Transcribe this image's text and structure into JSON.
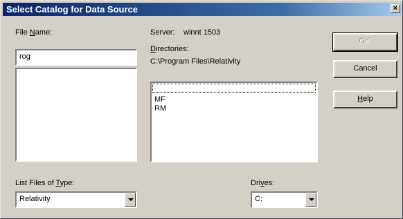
{
  "window": {
    "title": "Select Catalog for Data Source",
    "close_glyph": "×"
  },
  "file_name": {
    "label_prefix": "File ",
    "label_mnemonic": "N",
    "label_suffix": "ame:",
    "value": "rog",
    "files": []
  },
  "server": {
    "label": "Server:",
    "value": "winnt 1503"
  },
  "directories": {
    "label_mnemonic": "D",
    "label_suffix": "irectories:",
    "current_path": "C:\\Program Files\\Relativity",
    "items": [
      "MF",
      "RM"
    ]
  },
  "list_files_of_type": {
    "label_prefix": "List Files of ",
    "label_mnemonic": "T",
    "label_suffix": "ype:",
    "value": "Relativity"
  },
  "drives": {
    "label_prefix": "Dri",
    "label_mnemonic": "v",
    "label_suffix": "es:",
    "value": "C:"
  },
  "buttons": {
    "ok": "OK",
    "cancel": "Cancel",
    "help_mnemonic": "H",
    "help_suffix": "elp"
  },
  "icons": {
    "combo_arrow": "chevron-down-icon",
    "close": "close-icon"
  }
}
